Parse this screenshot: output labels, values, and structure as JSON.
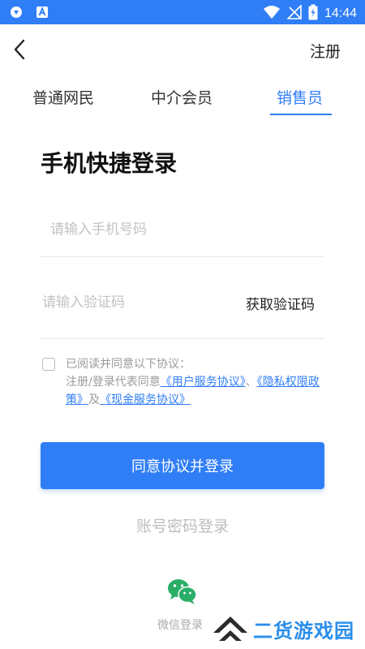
{
  "status_bar": {
    "time": "14:44",
    "icons": [
      "shield-app-icon",
      "a-app-icon",
      "wifi-icon",
      "no-signal-icon",
      "battery-charging-icon"
    ],
    "color": "#2f7ef6"
  },
  "header": {
    "back_icon": "chevron-left-icon",
    "register_label": "注册"
  },
  "tabs": [
    {
      "label": "普通网民",
      "active": false
    },
    {
      "label": "中介会员",
      "active": false
    },
    {
      "label": "销售员",
      "active": true
    }
  ],
  "login": {
    "title": "手机快捷登录",
    "phone_placeholder": "请输入手机号码",
    "phone_value": "",
    "code_placeholder": "请输入验证码",
    "code_value": "",
    "get_code_label": "获取验证码"
  },
  "agreement": {
    "checked": false,
    "intro": "已阅读并同意以下协议：",
    "line_prefix": "注册/登录代表同意",
    "user_service_link": "《用户服务协议》",
    "sep1": "、",
    "privacy_link": "《隐私权限政策》",
    "sep2": "及",
    "cash_service_link": "《现金服务协议》"
  },
  "actions": {
    "login_button": "同意协议并登录",
    "password_login": "账号密码登录",
    "wechat_icon": "wechat-icon",
    "wechat_label": "微信登录"
  },
  "watermark": {
    "text": "二货游戏园"
  },
  "colors": {
    "accent": "#2f7ef6",
    "placeholder": "#c2c2c2",
    "muted": "#9a9a9a",
    "wechat": "#2aae67"
  }
}
